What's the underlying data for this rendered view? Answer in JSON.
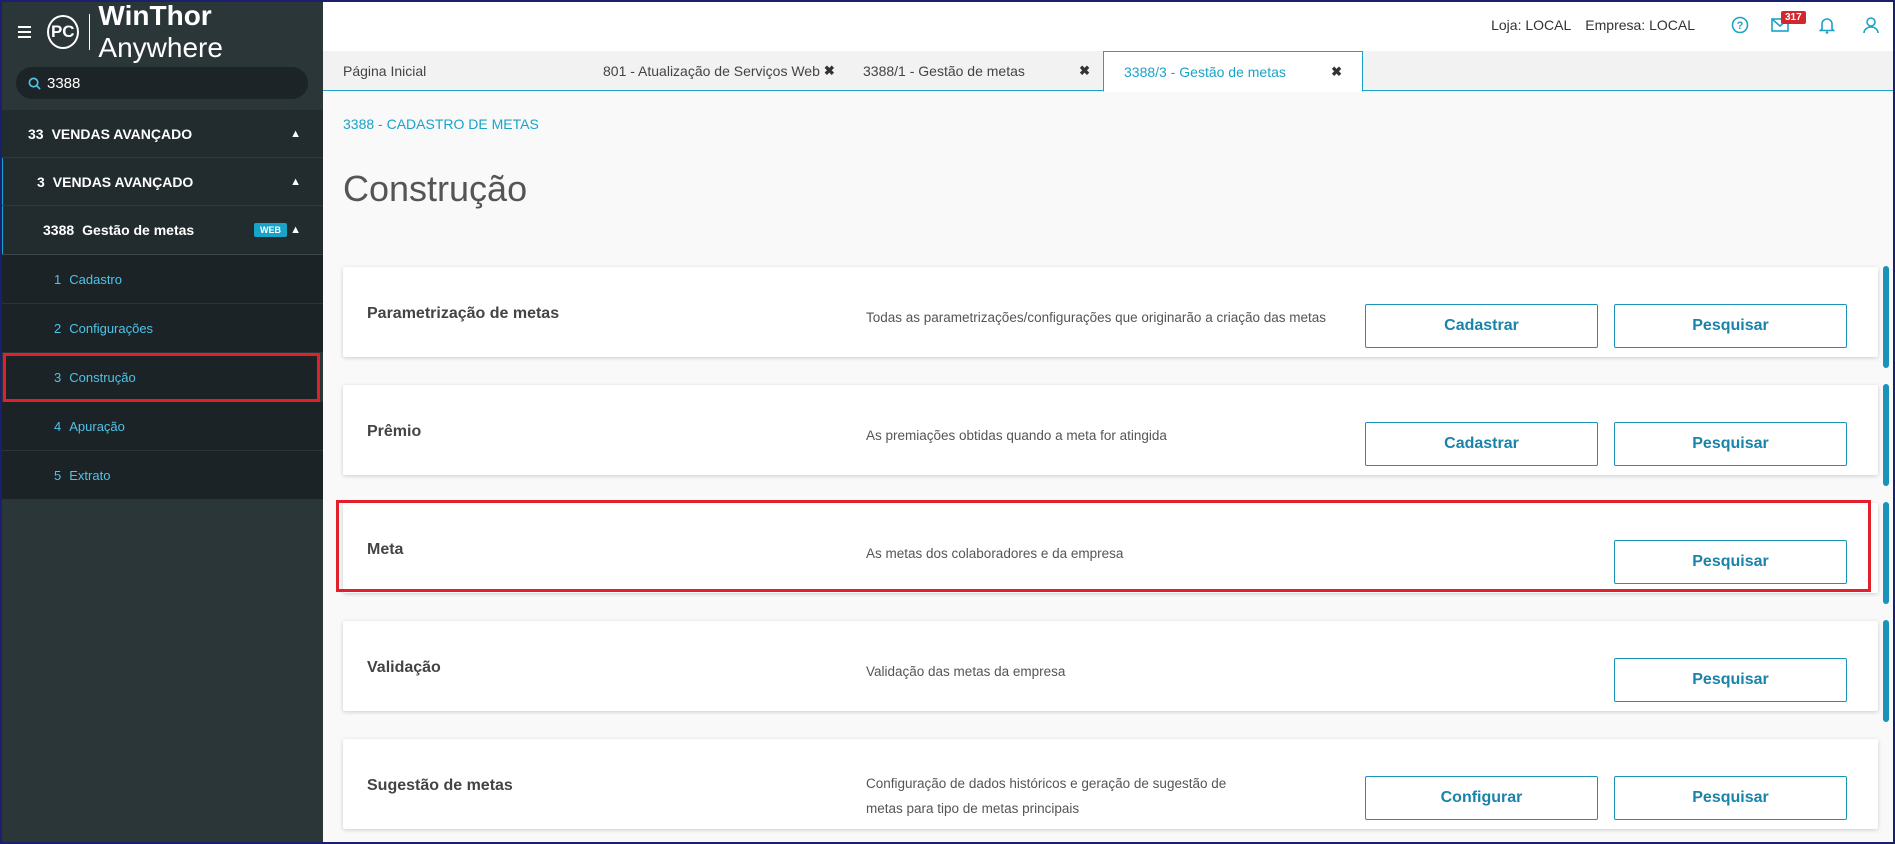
{
  "app": {
    "logo_badge": "PC",
    "name_bold": "WinThor",
    "name_light": " Anywhere"
  },
  "search": {
    "value": "3388"
  },
  "sidebar": {
    "level1": {
      "num": "33",
      "label": "VENDAS AVANÇADO"
    },
    "level2": {
      "num": "3",
      "label": "VENDAS AVANÇADO"
    },
    "level3": {
      "num": "3388",
      "label": "Gestão de metas",
      "badge": "WEB"
    },
    "items": [
      {
        "num": "1",
        "label": "Cadastro"
      },
      {
        "num": "2",
        "label": "Configurações"
      },
      {
        "num": "3",
        "label": "Construção"
      },
      {
        "num": "4",
        "label": "Apuração"
      },
      {
        "num": "5",
        "label": "Extrato"
      }
    ]
  },
  "topbar": {
    "loja": "Loja: LOCAL",
    "empresa": "Empresa: LOCAL",
    "mail_count": "317"
  },
  "tabs": [
    {
      "label": "Página Inicial"
    },
    {
      "label": "801 - Atualização de Serviços Web"
    },
    {
      "label": "3388/1 - Gestão de metas"
    },
    {
      "label": "3388/3 - Gestão de metas"
    }
  ],
  "main": {
    "breadcrumb": "3388 - CADASTRO DE METAS",
    "title": "Construção",
    "cards": [
      {
        "title": "Parametrização de metas",
        "desc": "Todas as parametrizações/configurações que originarão a criação das metas",
        "btn1": "Cadastrar",
        "btn2": "Pesquisar"
      },
      {
        "title": "Prêmio",
        "desc": "As premiações obtidas quando a meta for atingida",
        "btn1": "Cadastrar",
        "btn2": "Pesquisar"
      },
      {
        "title": "Meta",
        "desc": "As metas dos colaboradores e da empresa",
        "btn2": "Pesquisar"
      },
      {
        "title": "Validação",
        "desc": "Validação das metas da empresa",
        "btn2": "Pesquisar"
      },
      {
        "title": "Sugestão de metas",
        "desc": "Configuração de dados históricos e geração de sugestão de metas para tipo de metas principais",
        "btn1": "Configurar",
        "btn2": "Pesquisar"
      }
    ]
  },
  "colors": {
    "accent": "#1aa3c8",
    "highlight": "#e0202a",
    "sidebar_bg": "#2b3639"
  }
}
